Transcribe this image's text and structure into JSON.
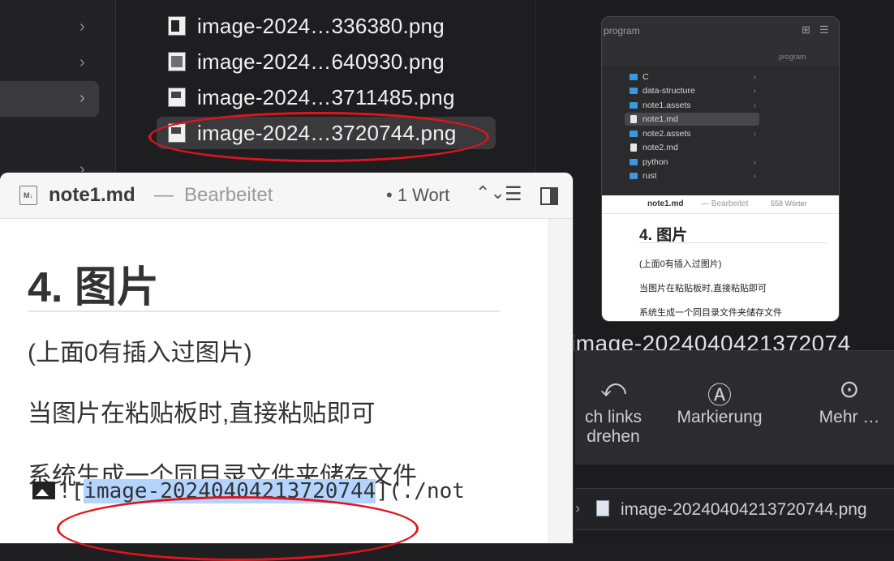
{
  "file_list": {
    "items": [
      {
        "name": "image-2024…336380.png",
        "selected": false
      },
      {
        "name": "image-2024…640930.png",
        "selected": false
      },
      {
        "name": "image-2024…3711485.png",
        "selected": false
      },
      {
        "name": "image-2024…3720744.png",
        "selected": true
      }
    ]
  },
  "preview": {
    "folder_title": "program",
    "folder_subtitle": "program",
    "tree": [
      {
        "label": "C",
        "type": "folder"
      },
      {
        "label": "data-structure",
        "type": "folder"
      },
      {
        "label": "note1.assets",
        "type": "folder"
      },
      {
        "label": "note1.md",
        "type": "doc",
        "selected": true
      },
      {
        "label": "note2.assets",
        "type": "folder"
      },
      {
        "label": "note2.md",
        "type": "doc"
      },
      {
        "label": "python",
        "type": "folder"
      },
      {
        "label": "rust",
        "type": "folder"
      }
    ],
    "doc": {
      "filename": "note1.md",
      "status": "— Bearbeitet",
      "word_count": "558 Wörter",
      "heading": "4. 图片",
      "lines": [
        "(上面0有插入过图片)",
        "当图片在粘贴板时,直接粘贴即可",
        "系统生成一个同目录文件夹储存文件"
      ]
    }
  },
  "quicklook": {
    "file_title": "image-2024040421372074",
    "actions": [
      {
        "label": "ch links drehen",
        "icon": "rotate-icon"
      },
      {
        "label": "Markierung",
        "icon": "markup-icon"
      },
      {
        "label": "Mehr …",
        "icon": "more-icon"
      }
    ],
    "path_item": "image-20240404213720744.png"
  },
  "editor": {
    "filename": "note1.md",
    "separator": "—",
    "status": "Bearbeitet",
    "word_count": "• 1 Wort",
    "heading": "4. 图片",
    "paragraphs": [
      "(上面0有插入过图片)",
      "当图片在粘贴板时,直接粘贴即可",
      "系统生成一个同目录文件夹储存文件"
    ],
    "image_markdown": {
      "prefix": "![",
      "selected_text": "image-20240404213720744",
      "suffix": "](./not"
    }
  },
  "annotations": {
    "color": "#e0141c"
  }
}
